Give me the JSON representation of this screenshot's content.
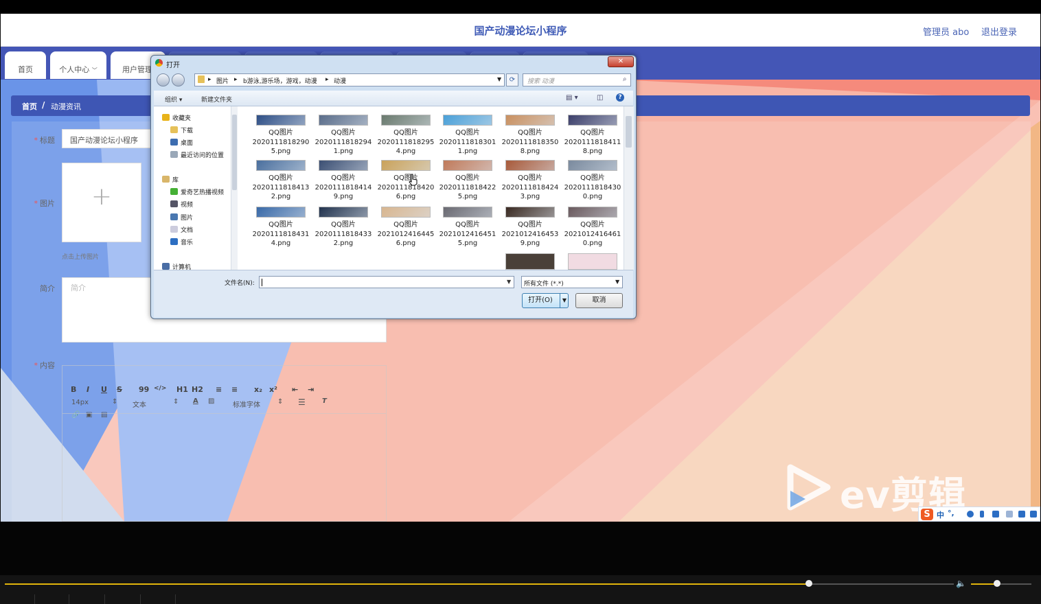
{
  "app": {
    "title": "国产动漫论坛小程序",
    "user_label": "管理员 abo",
    "logout_label": "退出登录"
  },
  "nav": {
    "tabs": [
      "首页",
      "个人中心",
      "用户管理"
    ]
  },
  "breadcrumb": {
    "home": "首页",
    "separator": "/",
    "current": "动漫资讯"
  },
  "form": {
    "title_label": "标题",
    "title_value": "国产动漫论坛小程序",
    "image_label": "图片",
    "upload_hint": "点击上传图片",
    "intro_label": "简介",
    "intro_placeholder": "简介",
    "content_label": "内容",
    "required_mark": "*"
  },
  "editor": {
    "buttons": [
      "B",
      "I",
      "U",
      "S",
      "99",
      "</>",
      "H1",
      "H2",
      "≡",
      "≡",
      "x₂",
      "x²",
      "⇤",
      "⇥"
    ],
    "font_size": "14px",
    "paragraph": "文本",
    "font_family": "标准字体"
  },
  "dialog": {
    "title": "打开",
    "close_label": "✕",
    "address_path": [
      "图片",
      "b游泳,游乐场，游戏，动漫",
      "动漫"
    ],
    "search_placeholder": "搜索 动漫",
    "organize_label": "组织",
    "new_folder_label": "新建文件夹",
    "nav_items": [
      {
        "label": "收藏夹",
        "icon": "star-icon",
        "color": "#e8b31a"
      },
      {
        "label": "下载",
        "icon": "download-folder-icon",
        "color": "#e6c15a"
      },
      {
        "label": "桌面",
        "icon": "desktop-icon",
        "color": "#3d6db0"
      },
      {
        "label": "最近访问的位置",
        "icon": "recent-places-icon",
        "color": "#9aa8b8"
      },
      {
        "label": "库",
        "icon": "library-icon",
        "color": "#d9b66a"
      },
      {
        "label": "爱奇艺热播视频",
        "icon": "iqiyi-icon",
        "color": "#45b035"
      },
      {
        "label": "视频",
        "icon": "video-library-icon",
        "color": "#556"
      },
      {
        "label": "图片",
        "icon": "pictures-library-icon",
        "color": "#4a78b0"
      },
      {
        "label": "文档",
        "icon": "documents-library-icon",
        "color": "#ccd"
      },
      {
        "label": "音乐",
        "icon": "music-library-icon",
        "color": "#2d6fc2"
      },
      {
        "label": "计算机",
        "icon": "computer-icon",
        "color": "#4a6ea5"
      }
    ],
    "files": [
      {
        "line1": "QQ图片",
        "line2": "2020111818290",
        "line3": "5.png",
        "color": "#2e4f86"
      },
      {
        "line1": "QQ图片",
        "line2": "2020111818294",
        "line3": "1.png",
        "color": "#5a6d8a"
      },
      {
        "line1": "QQ图片",
        "line2": "2020111818295",
        "line3": "4.png",
        "color": "#6a7a6e"
      },
      {
        "line1": "QQ图片",
        "line2": "2020111818301",
        "line3": "1.png",
        "color": "#4aa0d8"
      },
      {
        "line1": "QQ图片",
        "line2": "2020111818350",
        "line3": "8.png",
        "color": "#c99060"
      },
      {
        "line1": "QQ图片",
        "line2": "2020111818411",
        "line3": "8.png",
        "color": "#3c3f6a"
      },
      {
        "line1": "QQ图片",
        "line2": "2020111818413",
        "line3": "2.png",
        "color": "#4a6f9e"
      },
      {
        "line1": "QQ图片",
        "line2": "2020111818414",
        "line3": "9.png",
        "color": "#3b4f73"
      },
      {
        "line1": "QQ图片",
        "line2": "2020111818420",
        "line3": "6.png",
        "color": "#caa25a"
      },
      {
        "line1": "QQ图片",
        "line2": "2020111818422",
        "line3": "5.png",
        "color": "#c07a5a"
      },
      {
        "line1": "QQ图片",
        "line2": "2020111818424",
        "line3": "3.png",
        "color": "#a85a3a"
      },
      {
        "line1": "QQ图片",
        "line2": "2020111818430",
        "line3": "0.png",
        "color": "#7a8a9e"
      },
      {
        "line1": "QQ图片",
        "line2": "2020111818431",
        "line3": "4.png",
        "color": "#3a6aa8"
      },
      {
        "line1": "QQ图片",
        "line2": "2020111818433",
        "line3": "2.png",
        "color": "#22334e"
      },
      {
        "line1": "QQ图片",
        "line2": "2021012416445",
        "line3": "6.png",
        "color": "#d8b690"
      },
      {
        "line1": "QQ图片",
        "line2": "2021012416451",
        "line3": "5.png",
        "color": "#6a6a72"
      },
      {
        "line1": "QQ图片",
        "line2": "2021012416453",
        "line3": "9.png",
        "color": "#3a2a22"
      },
      {
        "line1": "QQ图片",
        "line2": "2021012416461",
        "line3": "0.png",
        "color": "#6a5a5e"
      }
    ],
    "extra_thumbs": [
      {
        "color": "#4a4038"
      },
      {
        "color": "#f1dbe2"
      }
    ],
    "filename_label": "文件名(N):",
    "filetype_value": "所有文件 (*.*)",
    "open_label": "打开(O)",
    "cancel_label": "取消"
  },
  "watermark": {
    "text": "ev剪辑"
  },
  "ime": {
    "logo": "S",
    "mode": "中"
  },
  "player": {
    "progress": 0.847,
    "volume": 0.43
  },
  "colors": {
    "brand_blue": "#4456b6",
    "accent_title": "#3f5bb6",
    "progress": "#e1b50c"
  }
}
